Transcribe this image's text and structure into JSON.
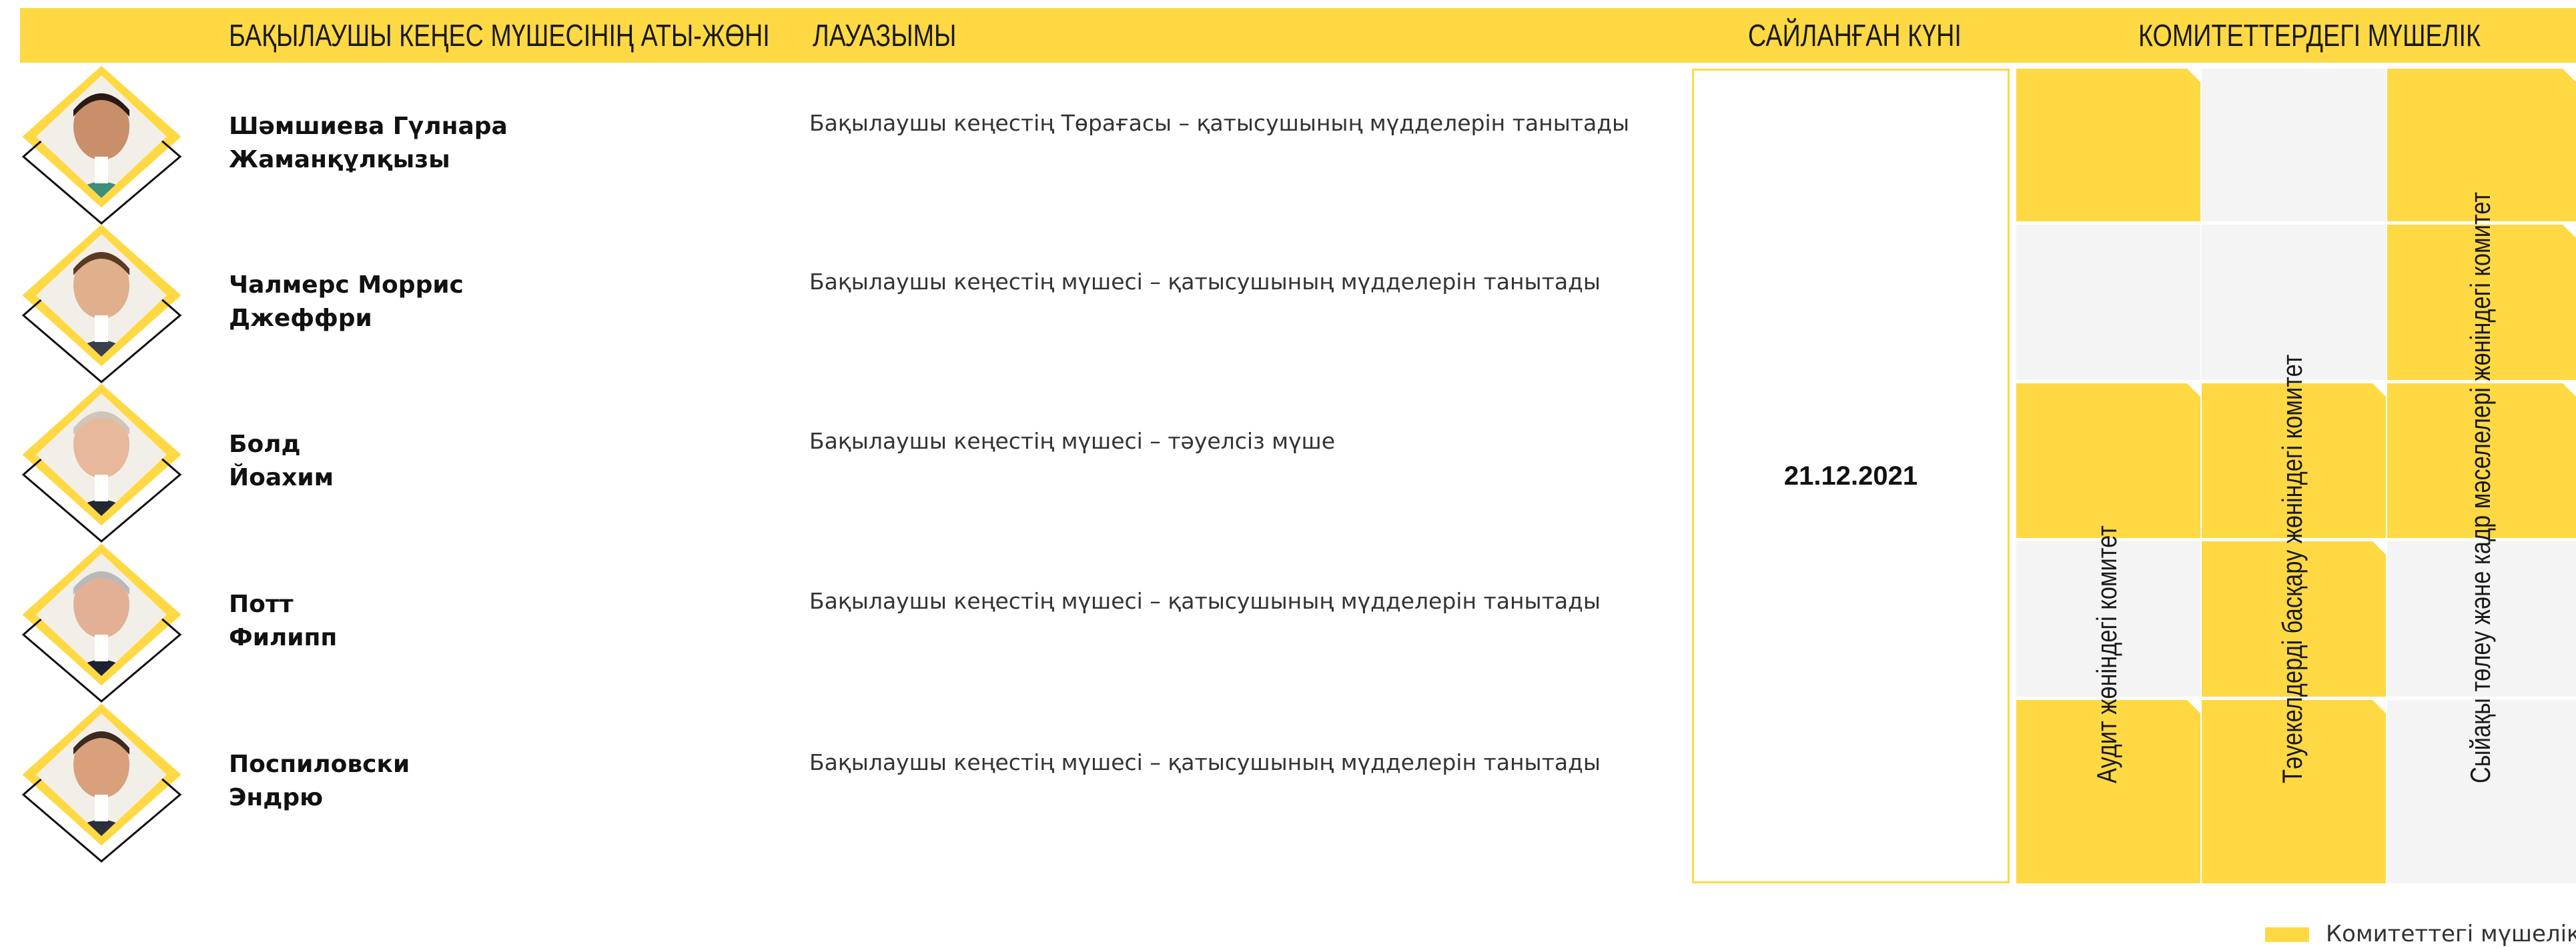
{
  "header": {
    "col_name": "БАҚЫЛАУШЫ КЕҢЕС МҮШЕСІНІҢ АТЫ-ЖӨНІ",
    "col_position": "ЛАУАЗЫМЫ",
    "col_date": "САЙЛАНҒАН КҮНІ",
    "col_committees": "КОМИТЕТТЕРДЕГІ МҮШЕЛІК"
  },
  "members": [
    {
      "name_line1": "Шәмшиева Гүлнара",
      "name_line2": "Жаманқұлқызы",
      "position": "Бақылаушы кеңестің Төрағасы –  қатысушының мүдделерін танытады"
    },
    {
      "name_line1": "Чалмерс Моррис",
      "name_line2": "Джеффри",
      "position": "Бақылаушы кеңестің мүшесі –  қатысушының мүдделерін танытады"
    },
    {
      "name_line1": "Болд",
      "name_line2": "Йоахим",
      "position": "Бақылаушы кеңестің мүшесі – тәуелсіз мүше"
    },
    {
      "name_line1": "Потт",
      "name_line2": "Филипп",
      "position": "Бақылаушы кеңестің мүшесі –  қатысушының мүдделерін танытады"
    },
    {
      "name_line1": "Поспиловски",
      "name_line2": "Эндрю",
      "position": "Бақылаушы кеңестің мүшесі –  қатысушының мүдделерін танытады"
    }
  ],
  "election_date": "21.12.2021",
  "committees": [
    {
      "name": "Аудит жөніндегі комитет",
      "membership": [
        true,
        false,
        true,
        false,
        true
      ]
    },
    {
      "name": "Тәуекелдерді басқару жөніндегі комитет",
      "membership": [
        false,
        false,
        true,
        true,
        true
      ]
    },
    {
      "name": "Сыйақы төлеу және кадр мәселелері жөніндегі комитет",
      "membership": [
        true,
        true,
        true,
        false,
        false
      ]
    }
  ],
  "legend": {
    "label": "Комитеттегі мүшелік",
    "color": "#FFD944"
  },
  "colors": {
    "accent": "#FFD944",
    "empty_cell": "#F4F4F4"
  }
}
